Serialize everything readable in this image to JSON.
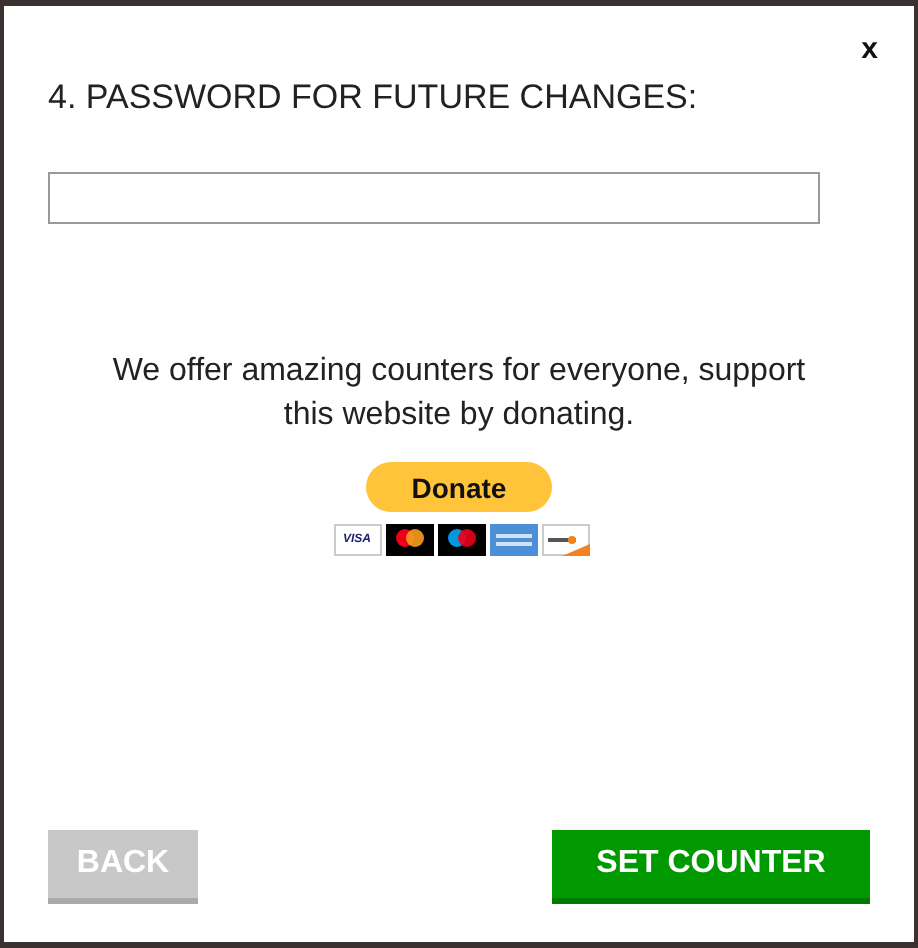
{
  "dialog": {
    "close": "x",
    "title": "4. PASSWORD FOR FUTURE CHANGES:"
  },
  "message": "We offer amazing counters for everyone, support this website by donating.",
  "donate_button": "Donate",
  "cards": [
    {
      "kind": "visa",
      "label": "VISA"
    },
    {
      "kind": "mastercard"
    },
    {
      "kind": "maestro"
    },
    {
      "kind": "amex"
    },
    {
      "kind": "discover"
    }
  ],
  "buttons": [
    {
      "label": "BACK",
      "disabled": true
    },
    {
      "label": "SET COUNTER",
      "disabled": false
    }
  ]
}
